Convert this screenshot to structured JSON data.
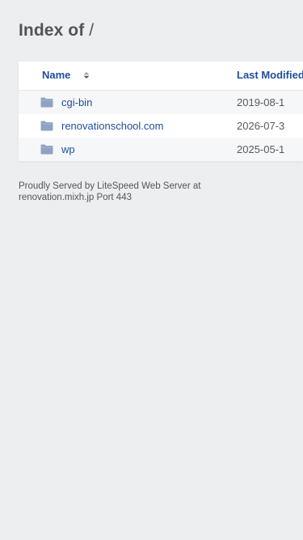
{
  "page": {
    "title_prefix": "Index of",
    "title_path": "/"
  },
  "table": {
    "headers": {
      "name": "Name",
      "last_modified": "Last Modified"
    },
    "rows": [
      {
        "name": "cgi-bin",
        "date": "2019-08-1",
        "icon": "folder-icon"
      },
      {
        "name": "renovationschool.com",
        "date": "2026-07-3",
        "icon": "folder-icon"
      },
      {
        "name": "wp",
        "date": "2025-05-1",
        "icon": "folder-icon"
      }
    ]
  },
  "footer": {
    "line1": "Proudly Served by LiteSpeed Web Server at",
    "line2": "renovation.mixh.jp Port 443"
  },
  "colors": {
    "link": "#1f4e9c",
    "folder": "#8ea3c4",
    "background": "#eceef0"
  }
}
